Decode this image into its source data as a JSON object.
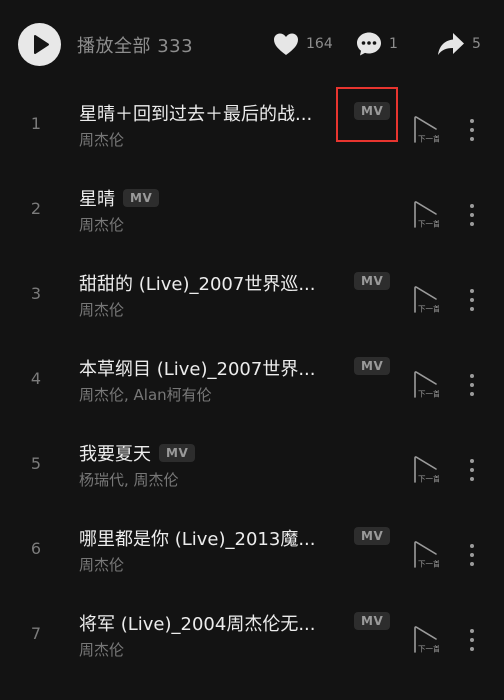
{
  "header": {
    "play_all_label": "播放全部 333",
    "likes": "164",
    "comments": "1",
    "shares": "5"
  },
  "songs": [
    {
      "index": "1",
      "title": "星晴＋回到过去＋最后的战...",
      "mv": "MV",
      "artist": "周杰伦",
      "mv_inline": false,
      "highlighted": true
    },
    {
      "index": "2",
      "title": "星晴",
      "mv": "MV",
      "artist": "周杰伦",
      "mv_inline": true
    },
    {
      "index": "3",
      "title": "甜甜的 (Live)_2007世界巡...",
      "mv": "MV",
      "artist": "周杰伦",
      "mv_inline": false
    },
    {
      "index": "4",
      "title": "本草纲目 (Live)_2007世界...",
      "mv": "MV",
      "artist": "周杰伦, Alan柯有伦",
      "mv_inline": false
    },
    {
      "index": "5",
      "title": "我要夏天",
      "mv": "MV",
      "artist": "杨瑞代, 周杰伦",
      "mv_inline": true
    },
    {
      "index": "6",
      "title": "哪里都是你 (Live)_2013魔...",
      "mv": "MV",
      "artist": "周杰伦",
      "mv_inline": false
    },
    {
      "index": "7",
      "title": "将军 (Live)_2004周杰伦无...",
      "mv": "MV",
      "artist": "周杰伦",
      "mv_inline": false
    }
  ],
  "next_icon_label": "下一首",
  "colors": {
    "background": "#131313",
    "highlight": "#e8352f",
    "text": "#ececec",
    "muted": "#787878"
  }
}
